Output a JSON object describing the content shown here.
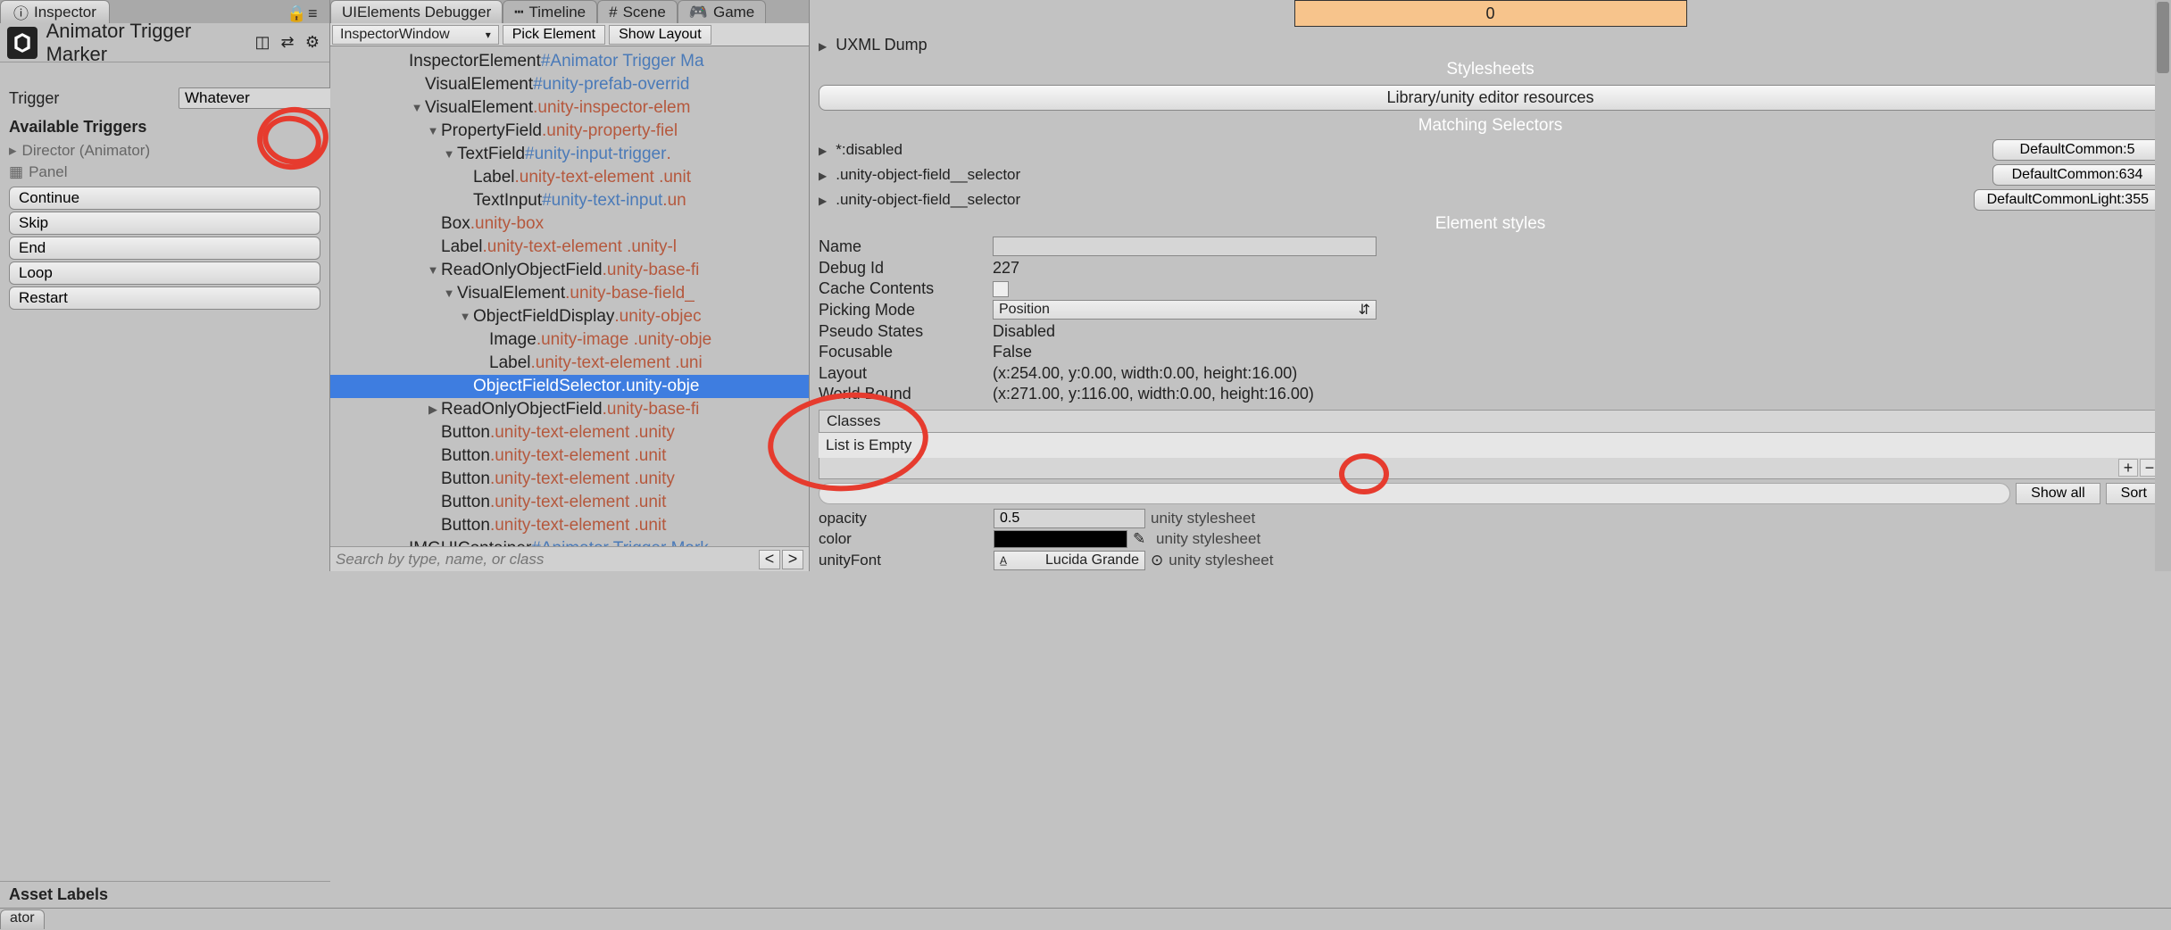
{
  "inspector": {
    "tab_label": "Inspector",
    "component_title": "Animator Trigger Marker",
    "trigger_label": "Trigger",
    "trigger_value": "Whatever",
    "available_header": "Available Triggers",
    "items": [
      {
        "label": "Director (Animator)"
      },
      {
        "label": "Panel"
      }
    ],
    "buttons": [
      "Continue",
      "Skip",
      "End",
      "Loop",
      "Restart"
    ],
    "asset_labels": "Asset Labels"
  },
  "debugger": {
    "tabs": [
      {
        "label": "UIElements Debugger",
        "active": true
      },
      {
        "label": "Timeline",
        "icon": "timeline"
      },
      {
        "label": "Scene",
        "icon": "scene"
      },
      {
        "label": "Game",
        "icon": "game"
      }
    ],
    "toolbar": {
      "dropdown": "InspectorWindow",
      "pick": "Pick Element",
      "layout": "Show Layout"
    },
    "tree": [
      {
        "indent": 4,
        "foldout": "",
        "type": "InspectorElement",
        "id": "#Animator Trigger Ma"
      },
      {
        "indent": 5,
        "foldout": "",
        "type": "VisualElement",
        "id": "#unity-prefab-overrid"
      },
      {
        "indent": 5,
        "foldout": "down",
        "type": "VisualElement",
        "class": ".unity-inspector-elem"
      },
      {
        "indent": 6,
        "foldout": "down",
        "type": "PropertyField",
        "class": ".unity-property-fiel"
      },
      {
        "indent": 7,
        "foldout": "down",
        "type": "TextField",
        "id": "#unity-input-trigger",
        "class": "."
      },
      {
        "indent": 8,
        "foldout": "",
        "type": "Label",
        "class": ".unity-text-element .unit"
      },
      {
        "indent": 8,
        "foldout": "",
        "type": "TextInput",
        "id": "#unity-text-input",
        "class": ".un"
      },
      {
        "indent": 6,
        "foldout": "",
        "type": "Box",
        "class": ".unity-box"
      },
      {
        "indent": 6,
        "foldout": "",
        "type": "Label",
        "class": ".unity-text-element .unity-l"
      },
      {
        "indent": 6,
        "foldout": "down",
        "type": "ReadOnlyObjectField",
        "class": ".unity-base-fi"
      },
      {
        "indent": 7,
        "foldout": "down",
        "type": "VisualElement",
        "class": ".unity-base-field_"
      },
      {
        "indent": 8,
        "foldout": "down",
        "type": "ObjectFieldDisplay",
        "class": ".unity-objec"
      },
      {
        "indent": 9,
        "foldout": "",
        "type": "Image",
        "class": ".unity-image .unity-obje"
      },
      {
        "indent": 9,
        "foldout": "",
        "type": "Label",
        "class": ".unity-text-element .uni"
      },
      {
        "indent": 8,
        "foldout": "",
        "type": "ObjectFieldSelector",
        "class": ".unity-obje",
        "selected": true
      },
      {
        "indent": 6,
        "foldout": "right",
        "type": "ReadOnlyObjectField",
        "class": ".unity-base-fi"
      },
      {
        "indent": 6,
        "foldout": "",
        "type": "Button",
        "class": ".unity-text-element .unity"
      },
      {
        "indent": 6,
        "foldout": "",
        "type": "Button",
        "class": ".unity-text-element .unit"
      },
      {
        "indent": 6,
        "foldout": "",
        "type": "Button",
        "class": ".unity-text-element .unity"
      },
      {
        "indent": 6,
        "foldout": "",
        "type": "Button",
        "class": ".unity-text-element .unit"
      },
      {
        "indent": 6,
        "foldout": "",
        "type": "Button",
        "class": ".unity-text-element .unit"
      },
      {
        "indent": 4,
        "foldout": "",
        "type": "IMGUIContainer",
        "id": "#Animator Trigger Mark"
      }
    ],
    "search_placeholder": "Search by type, name, or class"
  },
  "props": {
    "orange_value": "0",
    "uxml_dump": "UXML Dump",
    "stylesheets_title": "Stylesheets",
    "library_btn": "Library/unity editor resources",
    "matching_title": "Matching Selectors",
    "selectors": [
      {
        "label": "*:disabled",
        "btn": "DefaultCommon:5"
      },
      {
        "label": ".unity-object-field__selector",
        "btn": "DefaultCommon:634"
      },
      {
        "label": ".unity-object-field__selector",
        "btn": "DefaultCommonLight:355"
      }
    ],
    "element_styles_title": "Element styles",
    "fields": {
      "name_label": "Name",
      "name_value": "",
      "debugid_label": "Debug Id",
      "debugid_value": "227",
      "cache_label": "Cache Contents",
      "picking_label": "Picking Mode",
      "picking_value": "Position",
      "pseudo_label": "Pseudo States",
      "pseudo_value": "Disabled",
      "focusable_label": "Focusable",
      "focusable_value": "False",
      "layout_label": "Layout",
      "layout_value": "(x:254.00, y:0.00, width:0.00, height:16.00)",
      "world_label": "World Bound",
      "world_value": "(x:271.00, y:116.00, width:0.00, height:16.00)"
    },
    "classes_label": "Classes",
    "classes_empty": "List is Empty",
    "showall": "Show all",
    "sort": "Sort",
    "styles": [
      {
        "name": "opacity",
        "value": "0.5",
        "source": "unity stylesheet",
        "type": "text"
      },
      {
        "name": "color",
        "value": "#000000",
        "source": "unity stylesheet",
        "type": "color"
      },
      {
        "name": "unityFont",
        "value": "Lucida Grande",
        "source": "unity stylesheet",
        "type": "object"
      }
    ]
  },
  "bottom": {
    "tab": "ator"
  }
}
